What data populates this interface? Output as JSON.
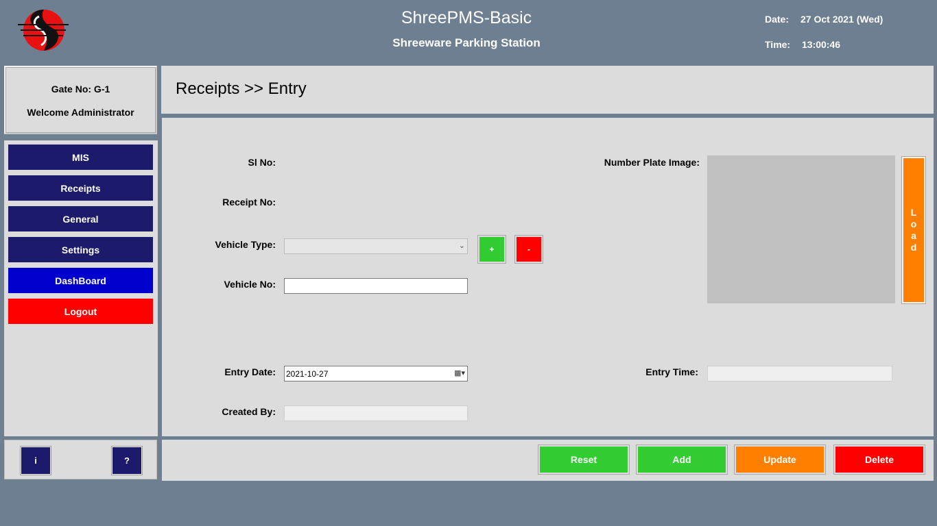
{
  "header": {
    "app_title": "ShreePMS-Basic",
    "app_subtitle": "Shreeware Parking Station",
    "date_label": "Date:",
    "date_value": "27 Oct 2021 (Wed)",
    "time_label": "Time:",
    "time_value": "13:00:46",
    "logo_icon": "shreeware-logo-icon"
  },
  "user": {
    "gate": "Gate No: G-1",
    "welcome": "Welcome Administrator"
  },
  "nav": {
    "items": [
      {
        "label": "MIS",
        "color": "#1c1b6b"
      },
      {
        "label": "Receipts",
        "color": "#1c1b6b"
      },
      {
        "label": "General",
        "color": "#1c1b6b"
      },
      {
        "label": "Settings",
        "color": "#1c1b6b"
      },
      {
        "label": "DashBoard",
        "color": "#0000cc"
      },
      {
        "label": "Logout",
        "color": "#ff0000"
      }
    ]
  },
  "util": {
    "info_label": "i",
    "help_label": "?"
  },
  "breadcrumb": "Receipts >> Entry",
  "form": {
    "sl_no_label": "Sl No:",
    "receipt_no_label": "Receipt No:",
    "vehicle_type_label": "Vehicle Type:",
    "vehicle_type_value": "",
    "add_type_label": "+",
    "remove_type_label": "-",
    "vehicle_no_label": "Vehicle No:",
    "vehicle_no_value": "",
    "number_plate_label": "Number Plate Image:",
    "load_label": [
      "L",
      "o",
      "a",
      "d"
    ],
    "entry_date_label": "Entry Date:",
    "entry_date_value": "2021-10-27",
    "entry_time_label": "Entry Time:",
    "entry_time_value": "",
    "created_by_label": "Created By:",
    "created_by_value": ""
  },
  "actions": {
    "reset": "Reset",
    "add": "Add",
    "update": "Update",
    "delete": "Delete"
  },
  "colors": {
    "green": "#33cc33",
    "red": "#ff0000",
    "orange": "#ff8000",
    "navy": "#1c1b6b",
    "blue": "#0000cc",
    "background": "#6e7f91",
    "panel": "#dcdcdc"
  }
}
